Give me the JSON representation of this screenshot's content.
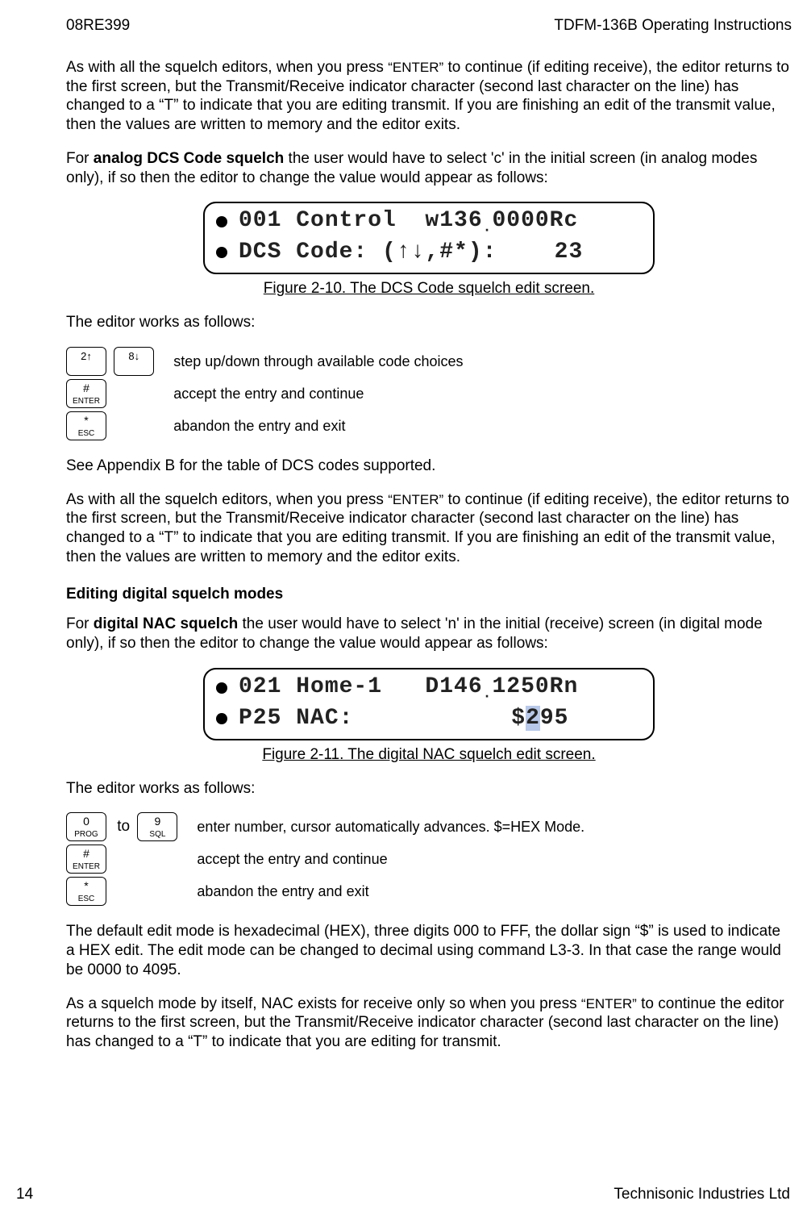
{
  "header": {
    "left": "08RE399",
    "right": "TDFM-136B Operating Instructions"
  },
  "intro_para": "As with all the squelch editors, when you press ",
  "enter_smallcaps": "“ENTER”",
  "intro_para_cont": " to continue (if editing receive), the editor returns to the first screen, but the Transmit/Receive indicator character (second last character on the line) has changed to a “T” to indicate that you are editing transmit.  If you are finishing an edit of the transmit value, then the values are written to memory and the editor exits.",
  "dcs_para_1_pre": "For ",
  "dcs_para_1_bold": "analog DCS Code squelch",
  "dcs_para_1_post": " the user would have to select 'c' in the initial screen (in analog modes only), if so then the editor to change the value would appear as follows:",
  "lcd1": {
    "row1_a": "001 Control  w136",
    "row1_dec": ".",
    "row1_b": "0000Rc",
    "row2": "DCS Code: (↑↓,#*):    23"
  },
  "fig1_caption": "Figure 2-10. The DCS Code squelch edit screen.",
  "works_as_follows": "The editor works as follows:",
  "keys1": {
    "r1_k1_main": "2↑",
    "r1_k1_sub": "",
    "r1_k2_main": "8↓",
    "r1_k2_sub": "",
    "r1_desc": "step up/down through available code choices",
    "r2_k_main": "#",
    "r2_k_sub": "ENTER",
    "r2_desc": "accept the entry and continue",
    "r3_k_main": "*",
    "r3_k_sub": "ESC",
    "r3_desc": "abandon the entry and exit"
  },
  "dcs_appendix": "See Appendix B for the table of DCS codes supported.",
  "repeat_para_pre": "As with all the squelch editors, when you press ",
  "repeat_para_post": " to continue (if editing receive), the editor returns to the first screen, but the Transmit/Receive indicator character (second last character on the line) has changed to a “T” to indicate that you are editing transmit.  If you are finishing an edit of the transmit value, then the values are written to memory and the editor exits.",
  "section2_head": "Editing digital squelch modes",
  "nac_para_pre": "For ",
  "nac_para_bold": "digital NAC squelch",
  "nac_para_post": " the user would have to select 'n' in the initial (receive) screen (in digital mode only), if so then the editor to change the value would appear as follows:",
  "lcd2": {
    "row1_a": "021 Home-1   D146",
    "row1_dec": ".",
    "row1_b": "1250Rn",
    "row2_a": "P25 NAC:           $",
    "row2_hl": "2",
    "row2_c": "95"
  },
  "fig2_caption": "Figure 2-11. The digital NAC squelch edit screen.",
  "works_as_follows_2": "The editor works as follows:",
  "keys2": {
    "r1_k1_main": "0",
    "r1_k1_sub": "PROG",
    "to": "to",
    "r1_k2_main": "9",
    "r1_k2_sub": "SQL",
    "r1_desc": "enter number, cursor automatically advances.  $=HEX Mode.",
    "r2_k_main": "#",
    "r2_k_sub": "ENTER",
    "r2_desc": "accept the entry and continue",
    "r3_k_main": "*",
    "r3_k_sub": "ESC",
    "r3_desc": "abandon the entry and exit"
  },
  "hex_para": "The default edit mode is hexadecimal (HEX), three digits 000 to FFF, the dollar sign “$” is used to indicate a HEX edit.  The edit mode can be changed to decimal using command L3-3.  In that case the range would be 0000 to 4095.",
  "final_para_pre": "As a squelch mode by itself, NAC exists for receive only so when you press ",
  "final_para_post": " to continue the editor returns to the first screen, but the Transmit/Receive indicator character (second last character on the line) has changed to a “T” to indicate that you are editing for transmit.",
  "footer": {
    "left": "14",
    "right": "Technisonic Industries Ltd"
  }
}
